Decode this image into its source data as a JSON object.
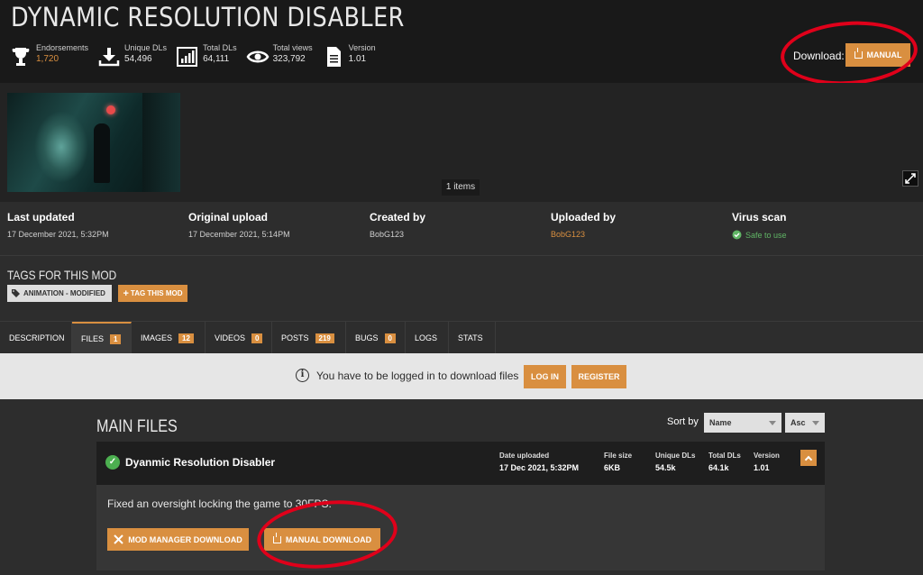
{
  "header": {
    "title": "DYNAMIC RESOLUTION DISABLER",
    "stats": [
      {
        "label": "Endorsements",
        "value": "1,720",
        "icon": "trophy-icon"
      },
      {
        "label": "Unique DLs",
        "value": "54,496",
        "icon": "download-icon"
      },
      {
        "label": "Total DLs",
        "value": "64,111",
        "icon": "bar-chart-icon"
      },
      {
        "label": "Total views",
        "value": "323,792",
        "icon": "eye-icon"
      },
      {
        "label": "Version",
        "value": "1.01",
        "icon": "document-icon"
      }
    ],
    "download_label": "Download:",
    "manual_button": "MANUAL"
  },
  "gallery": {
    "items_count": "1 items"
  },
  "info": {
    "last_updated": {
      "label": "Last updated",
      "value": "17 December 2021,  5:32PM"
    },
    "original_upload": {
      "label": "Original upload",
      "value": "17 December 2021,  5:14PM"
    },
    "created_by": {
      "label": "Created by",
      "value": "BobG123"
    },
    "uploaded_by": {
      "label": "Uploaded by",
      "value": "BobG123"
    },
    "virus_scan": {
      "label": "Virus scan",
      "value": "Safe to use"
    }
  },
  "tags": {
    "title": "TAGS FOR THIS MOD",
    "tag": "ANIMATION - MODIFIED",
    "tag_button": "TAG THIS MOD"
  },
  "tabs": [
    {
      "label": "DESCRIPTION",
      "count": ""
    },
    {
      "label": "FILES",
      "count": "1"
    },
    {
      "label": "IMAGES",
      "count": "12"
    },
    {
      "label": "VIDEOS",
      "count": "0"
    },
    {
      "label": "POSTS",
      "count": "219"
    },
    {
      "label": "BUGS",
      "count": "0"
    },
    {
      "label": "LOGS",
      "count": ""
    },
    {
      "label": "STATS",
      "count": ""
    }
  ],
  "login_bar": {
    "message": "You have to be logged in to download files",
    "login_button": "LOG IN",
    "register_button": "REGISTER"
  },
  "files": {
    "section_title": "MAIN FILES",
    "sort_label": "Sort by",
    "sort_field": "Name",
    "sort_order": "Asc",
    "file": {
      "name": "Dyanmic Resolution Disabler",
      "date_uploaded_label": "Date uploaded",
      "date_uploaded": "17 Dec 2021, 5:32PM",
      "file_size_label": "File size",
      "file_size": "6KB",
      "unique_dls_label": "Unique DLs",
      "unique_dls": "54.5k",
      "total_dls_label": "Total DLs",
      "total_dls": "64.1k",
      "version_label": "Version",
      "version": "1.01",
      "description": "Fixed an oversight locking the game to 30FPS.",
      "mod_manager_button": "MOD MANAGER DOWNLOAD",
      "manual_button": "MANUAL DOWNLOAD"
    }
  },
  "colors": {
    "accent": "#d98f40",
    "annotation": "#e0001a",
    "safe": "#60b565"
  }
}
